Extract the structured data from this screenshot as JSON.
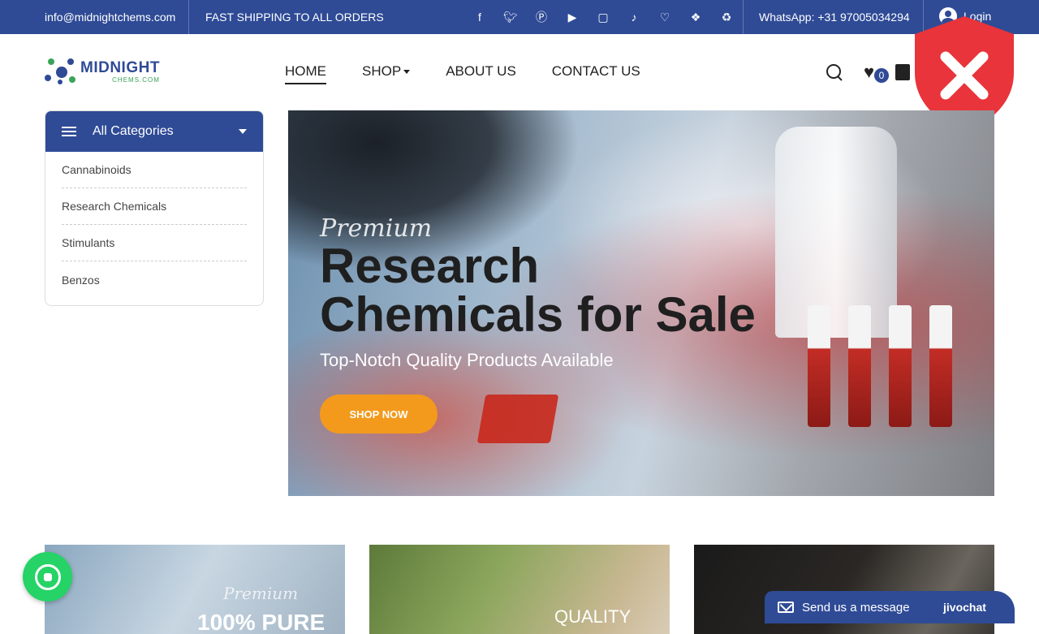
{
  "topbar": {
    "email": "info@midnightchems.com",
    "shipping": "FAST SHIPPING TO ALL ORDERS",
    "social_icons": [
      "facebook-icon",
      "twitter-icon",
      "pinterest-icon",
      "youtube-icon",
      "instagram-icon",
      "tiktok-icon",
      "heart-icon",
      "tags-icon",
      "recycle-icon"
    ],
    "whatsapp": "WhatsApp: +31 97005034294",
    "login": "Login"
  },
  "logo": {
    "line1": "MIDNIGHT",
    "line2": "CHEMS.COM"
  },
  "nav": {
    "items": [
      "HOME",
      "SHOP",
      "ABOUT US",
      "CONTACT US"
    ],
    "active": "HOME"
  },
  "header_icons": {
    "wishlist_count": "0"
  },
  "categories": {
    "title": "All Categories",
    "items": [
      "Cannabinoids",
      "Research Chemicals",
      "Stimulants",
      "Benzos"
    ]
  },
  "hero": {
    "pre": "Premium",
    "title": "Research Chemicals for Sale",
    "subtitle": "Top-Notch Quality Products Available",
    "button": "SHOP NOW"
  },
  "cards": [
    {
      "pre": "Premium",
      "big": "100% PURE"
    },
    {
      "big": "QUALITY"
    },
    {
      "big": ""
    }
  ],
  "chat": {
    "label": "Send us a message",
    "brand": "jivochat"
  },
  "colors": {
    "primary": "#2f4b96",
    "accent": "#f39a1d",
    "whatsapp": "#25d366",
    "warning": "#e8343a"
  }
}
